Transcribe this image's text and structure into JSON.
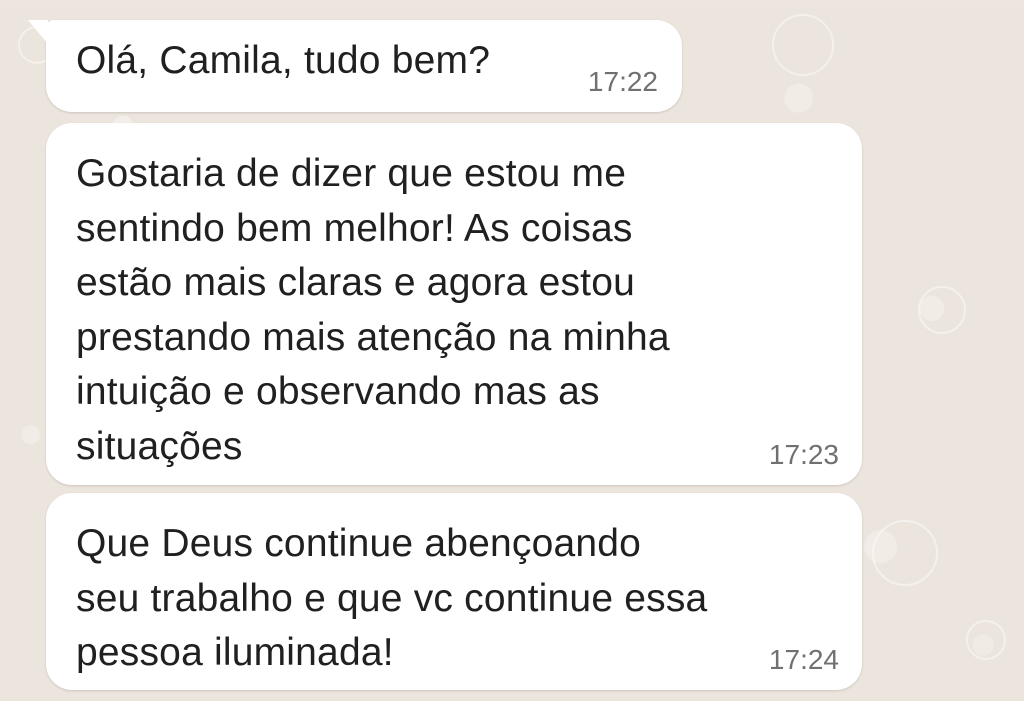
{
  "chat": {
    "messages": [
      {
        "text": "Olá, Camila, tudo bem?",
        "time": "17:22"
      },
      {
        "text": "Gostaria de dizer que estou me\nsentindo bem melhor! As coisas\nestão mais claras e agora estou\nprestando mais atenção na minha\nintuição e observando mas as\nsituações",
        "time": "17:23"
      },
      {
        "text": "Que Deus continue abençoando\nseu trabalho e que vc continue essa\npessoa iluminada!",
        "time": "17:24"
      }
    ]
  }
}
